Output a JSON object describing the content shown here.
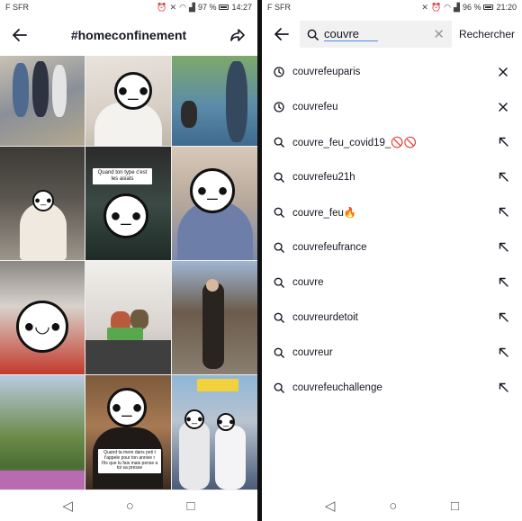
{
  "left": {
    "status": {
      "carrier": "F SFR",
      "battery": "97 %",
      "time": "14:27"
    },
    "header": {
      "title": "#homeconfinement"
    },
    "tiles": [
      {
        "caption": ""
      },
      {
        "caption": ""
      },
      {
        "caption": ""
      },
      {
        "caption": ""
      },
      {
        "caption": "Quand ton type c'est les asiats"
      },
      {
        "caption": ""
      },
      {
        "caption": ""
      },
      {
        "caption": ""
      },
      {
        "caption": ""
      },
      {
        "caption": ""
      },
      {
        "caption": "Quand ta mere dans peti t t'appele pour ton annive r t'ils que tu fais mais pense a toi sa presse"
      },
      {
        "caption": ""
      }
    ]
  },
  "right": {
    "status": {
      "carrier": "F SFR",
      "battery": "96 %",
      "time": "21:20"
    },
    "search": {
      "value": "couvre",
      "submit_label": "Rechercher"
    },
    "suggestions": [
      {
        "label": "couvrefeuparis",
        "type": "history",
        "action": "remove"
      },
      {
        "label": "couvrefeu",
        "type": "history",
        "action": "remove"
      },
      {
        "label": "couvre_feu_covid19_🚫🚫",
        "type": "suggest",
        "action": "fill"
      },
      {
        "label": "couvrefeu21h",
        "type": "suggest",
        "action": "fill"
      },
      {
        "label": "couvre_feu🔥",
        "type": "suggest",
        "action": "fill"
      },
      {
        "label": "couvrefeufrance",
        "type": "suggest",
        "action": "fill"
      },
      {
        "label": "couvre",
        "type": "suggest",
        "action": "fill"
      },
      {
        "label": "couvreurdetoit",
        "type": "suggest",
        "action": "fill"
      },
      {
        "label": "couvreur",
        "type": "suggest",
        "action": "fill"
      },
      {
        "label": "couvrefeuchallenge",
        "type": "suggest",
        "action": "fill"
      }
    ]
  },
  "icons": {
    "back": "arrow-left-icon",
    "share": "share-arrow-icon",
    "search": "magnifier-icon",
    "history": "clock-icon",
    "remove": "close-icon",
    "fill": "arrow-up-left-icon",
    "nav_back": "triangle-back-icon",
    "nav_home": "circle-home-icon",
    "nav_recent": "square-recent-icon"
  }
}
